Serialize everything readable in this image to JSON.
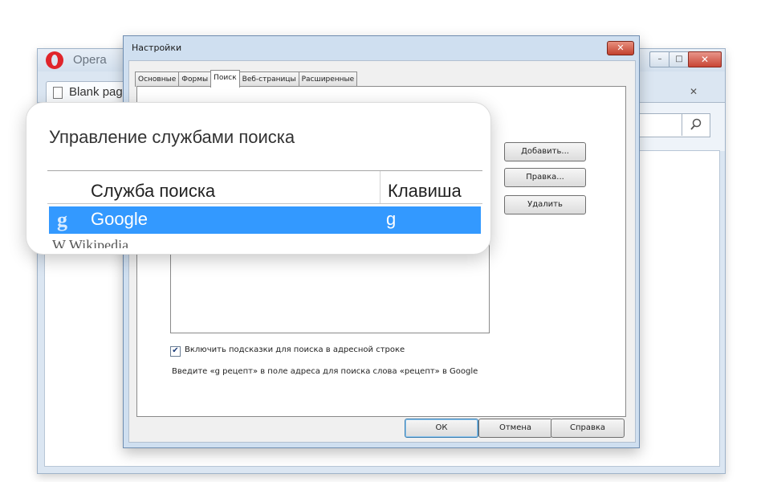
{
  "browser": {
    "title": "Opera",
    "tab_label": "Blank pag",
    "accent": "#e0252b"
  },
  "dialog": {
    "title": "Настройки",
    "tabs": [
      "Основные",
      "Формы",
      "Поиск",
      "Веб-страницы",
      "Расширенные"
    ],
    "active_tab": "Поиск",
    "side_buttons": {
      "add": "Добавить...",
      "edit": "Правка...",
      "delete": "Удалить"
    },
    "checkbox": {
      "label": "Включить подсказки для поиска в адресной строке",
      "checked": true
    },
    "hint": "Введите «g рецепт» в поле адреса для поиска слова «рецепт» в Google",
    "buttons": {
      "ok": "ОК",
      "cancel": "Отмена",
      "help": "Справка"
    }
  },
  "callout": {
    "title": "Управление службами поиска",
    "columns": {
      "service": "Служба поиска",
      "key": "Клавиша"
    },
    "rows": [
      {
        "icon": "google-g-icon",
        "icon_glyph": "g",
        "name": "Google",
        "key": "g",
        "selected": true,
        "selection_color": "#3399ff"
      }
    ],
    "next_row_partial": "W Wikipedia"
  }
}
